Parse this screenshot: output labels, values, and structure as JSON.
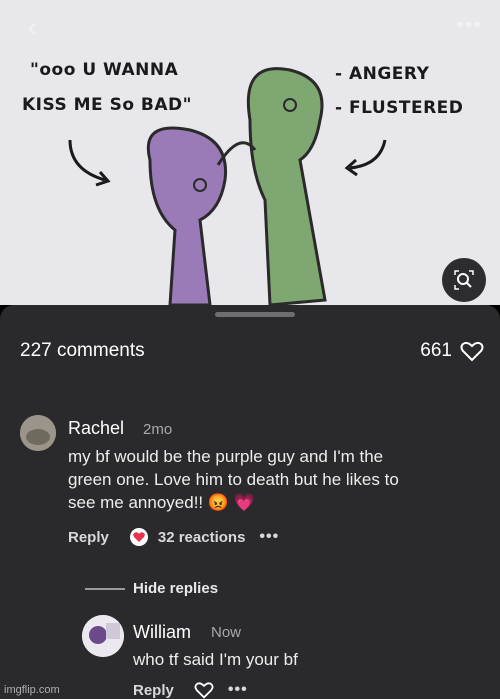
{
  "artwork": {
    "quote_line1": "\"ooo U WANNA",
    "quote_line2": "KISS ME So BAD\"",
    "note_line1": "- ANGERY",
    "note_line2": "- FLUSTERED",
    "purple_color": "#9b7ab8",
    "green_color": "#7fa772"
  },
  "topbar": {
    "back_glyph": "‹",
    "more_glyph": "•••"
  },
  "comments_header": {
    "count_label": "227 comments",
    "likes_count": "661"
  },
  "comments": [
    {
      "name": "Rachel",
      "time": "2mo",
      "text_lines": [
        "my bf would be the purple guy and I'm the",
        "green one. Love him to death but he likes to",
        "see me annoyed!! 😡 💗"
      ],
      "reply_label": "Reply",
      "reactions_label": "32 reactions",
      "more_glyph": "•••"
    }
  ],
  "hide_replies_label": "Hide replies",
  "reply": {
    "name": "William",
    "time": "Now",
    "text": "who tf said I'm your bf",
    "reply_label": "Reply",
    "more_glyph": "•••"
  },
  "watermark": "imgflip.com"
}
